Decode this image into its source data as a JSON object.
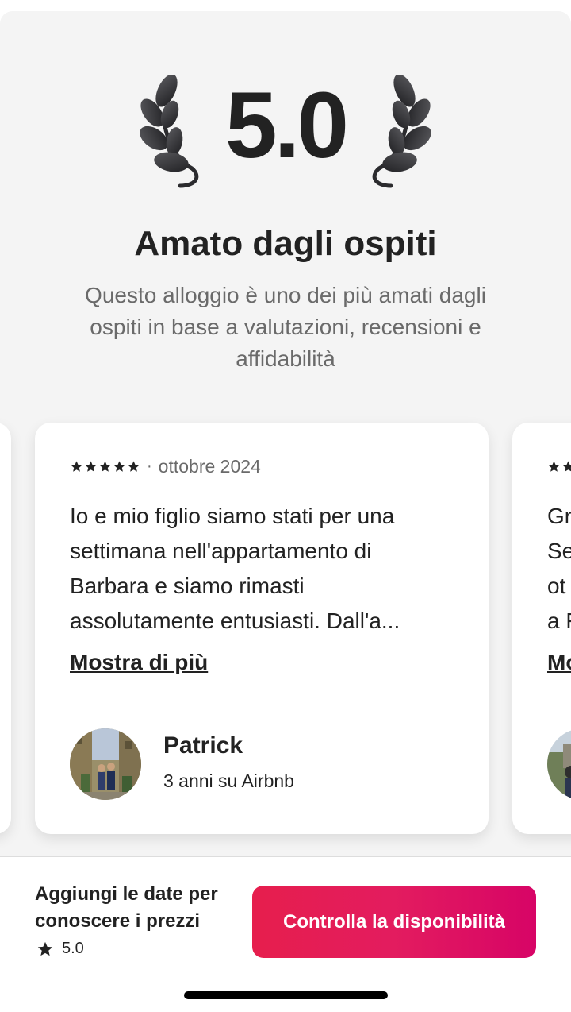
{
  "hero": {
    "score": "5.0",
    "title": "Amato dagli ospiti",
    "subtitle": "Questo alloggio è uno dei più amati dagli ospiti in base a valutazioni, recensioni e affidabilità",
    "laurel_icon": "laurel-icon"
  },
  "review": {
    "rating_stars": 5,
    "separator": "·",
    "date": "ottobre 2024",
    "text": "Io e mio figlio siamo stati per una settimana nell'appartamento di Barbara e siamo rimasti assolutamente entusiasti. Dall'a...",
    "show_more": "Mostra di più",
    "reviewer_name": "Patrick",
    "reviewer_meta": "3 anni su Airbnb"
  },
  "next_review_peek": {
    "lines": [
      "Gr",
      "Se",
      "ot",
      "a F"
    ],
    "show_more": "Mo"
  },
  "footer": {
    "text": "Aggiungi le date per conoscere i prezzi",
    "rating": "5.0",
    "cta_label": "Controlla la disponibilità"
  },
  "colors": {
    "accent": "#e31c5f",
    "text": "#222222",
    "muted": "#6a6a6a",
    "hero_bg": "#f4f4f4"
  }
}
